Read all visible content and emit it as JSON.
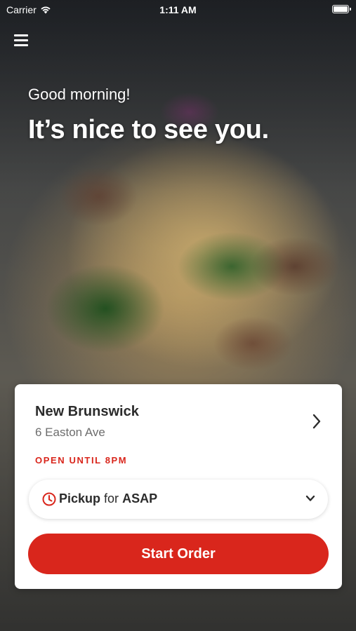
{
  "status_bar": {
    "carrier": "Carrier",
    "time": "1:11 AM"
  },
  "header": {
    "menu_icon": "hamburger-menu-icon"
  },
  "hero": {
    "greeting": "Good morning!",
    "headline": "It’s nice to see you."
  },
  "store_card": {
    "name": "New Brunswick",
    "address": "6 Easton Ave",
    "hours": "OPEN UNTIL 8PM",
    "order_type": "Pickup",
    "order_connector": "for",
    "order_time": "ASAP",
    "start_label": "Start Order"
  },
  "colors": {
    "accent": "#d9261c",
    "text_dark": "#2b2b2b",
    "text_muted": "#6d6d6d"
  }
}
